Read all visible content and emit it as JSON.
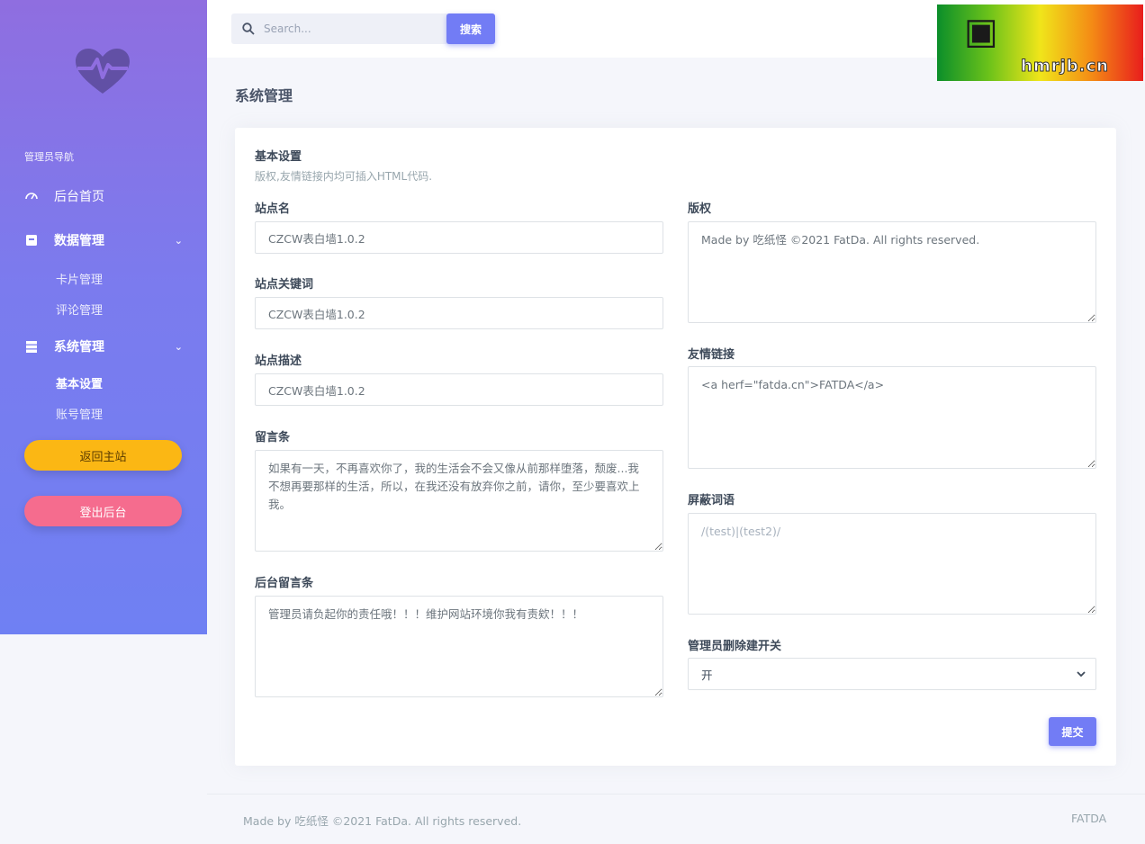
{
  "sidebar": {
    "caption": "管理员导航",
    "items": [
      {
        "label": "后台首页"
      },
      {
        "label": "数据管理"
      },
      {
        "label": "系统管理"
      }
    ],
    "data_sub": [
      {
        "label": "卡片管理"
      },
      {
        "label": "评论管理"
      }
    ],
    "system_sub": [
      {
        "label": "基本设置"
      },
      {
        "label": "账号管理"
      }
    ],
    "back_button": "返回主站",
    "logout_button": "登出后台"
  },
  "topbar": {
    "search_placeholder": "Search...",
    "search_button": "搜索",
    "watermark_text": "hmrjb.cn"
  },
  "page": {
    "title": "系统管理"
  },
  "card": {
    "title": "基本设置",
    "subtitle": "版权,友情链接内均可插入HTML代码."
  },
  "form": {
    "site_name": {
      "label": "站点名",
      "value": "CZCW表白墙1.0.2"
    },
    "site_keywords": {
      "label": "站点关键词",
      "value": "CZCW表白墙1.0.2"
    },
    "site_description": {
      "label": "站点描述",
      "value": "CZCW表白墙1.0.2"
    },
    "message_bar": {
      "label": "留言条",
      "value": "如果有一天，不再喜欢你了，我的生活会不会又像从前那样堕落，颓废...我不想再要那样的生活，所以，在我还没有放弃你之前，请你，至少要喜欢上我。"
    },
    "admin_message_bar": {
      "label": "后台留言条",
      "value": "管理员请负起你的责任哦！！！维护网站环境你我有责欸！！！"
    },
    "copyright": {
      "label": "版权",
      "value": "Made by 吃纸怪 ©2021 FatDa. All rights reserved."
    },
    "friend_links": {
      "label": "友情链接",
      "value": "<a herf=\"fatda.cn\">FATDA</a>"
    },
    "blocked_words": {
      "label": "屏蔽词语",
      "placeholder": "/(test)|(test2)/"
    },
    "admin_delete_switch": {
      "label": "管理员删除建开关",
      "selected": "开"
    },
    "submit": "提交"
  },
  "footer": {
    "left": "Made by 吃纸怪 ©2021 FatDa. All rights reserved.",
    "right": "FATDA"
  },
  "colors": {
    "accent": "#727cf5",
    "sidebar_top": "#8f6ee0",
    "sidebar_bottom": "#6f80f3",
    "back_button": "#fbb714",
    "logout_button": "#f56c8e"
  },
  "icons": {
    "logo": "heartbeat-icon",
    "dashboard": "speedometer-icon",
    "data": "box-icon",
    "system": "server-icon",
    "search": "search-icon"
  }
}
